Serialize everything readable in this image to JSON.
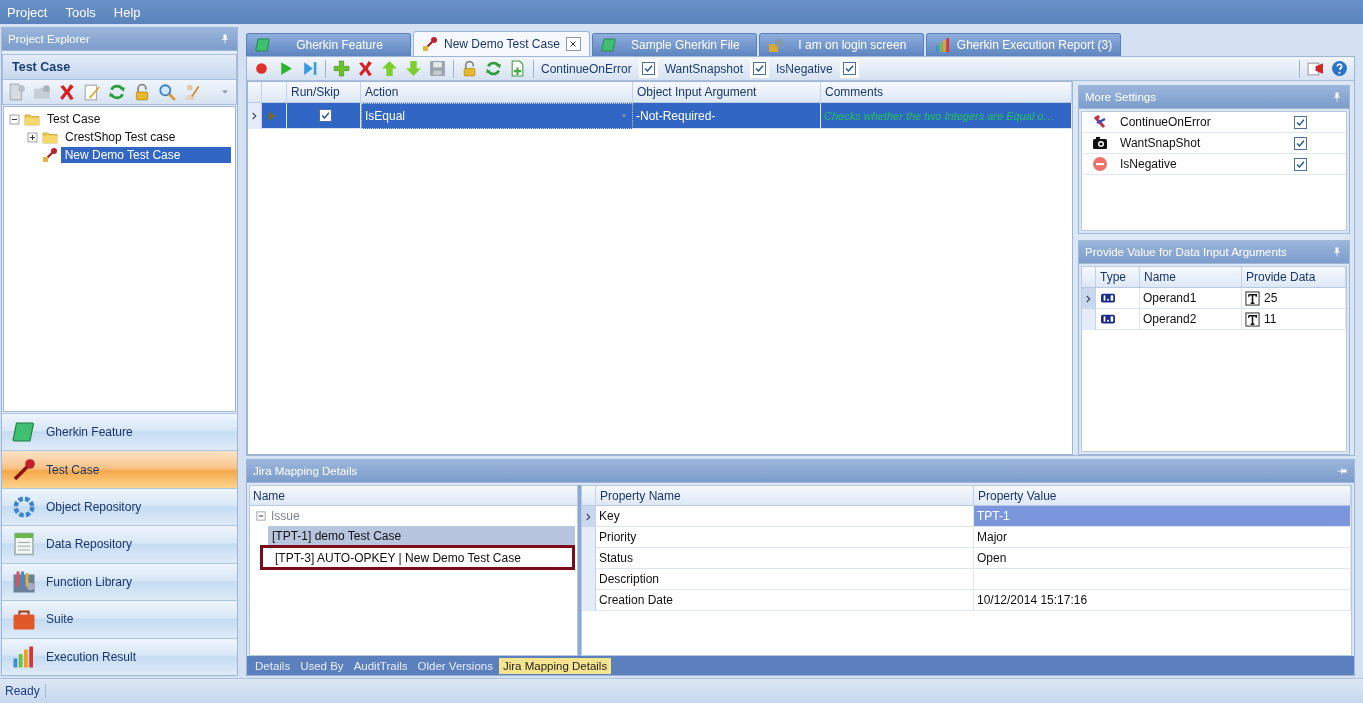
{
  "menu": [
    {
      "label": "Project"
    },
    {
      "label": "Tools"
    },
    {
      "label": "Help"
    }
  ],
  "explorer": {
    "title": "Project Explorer",
    "section_title": "Test Case",
    "tree": [
      {
        "label": "Test Case",
        "kind": "folder",
        "expanded": true,
        "selected": false,
        "children": [
          {
            "label": "CrestShop Test case",
            "kind": "folder",
            "expanded": false,
            "selected": false
          },
          {
            "label": "New Demo Test Case",
            "kind": "test_case",
            "selected": true
          }
        ]
      }
    ]
  },
  "nav": [
    {
      "label": "Gherkin Feature",
      "kind": "feature",
      "selected": false
    },
    {
      "label": "Test Case",
      "kind": "test_case",
      "selected": true
    },
    {
      "label": "Object Repository",
      "kind": "object_repository",
      "selected": false
    },
    {
      "label": "Data Repository",
      "kind": "data_repository",
      "selected": false
    },
    {
      "label": "Function Library",
      "kind": "function_library",
      "selected": false
    },
    {
      "label": "Suite",
      "kind": "suite",
      "selected": false
    },
    {
      "label": "Execution Result",
      "kind": "report",
      "selected": false
    }
  ],
  "tabs": [
    {
      "label": "Gherkin Feature",
      "kind": "feature",
      "selected": false
    },
    {
      "label": "New Demo Test Case",
      "kind": "test_case",
      "selected": true
    },
    {
      "label": "Sample Gherkin File",
      "kind": "feature",
      "selected": false
    },
    {
      "label": "I am on login screen",
      "kind": "screen",
      "selected": false
    },
    {
      "label": "Gherkin Execution Report (3)",
      "kind": "report",
      "selected": false
    }
  ],
  "toolbar_options": [
    {
      "label": "ContinueOnError",
      "checked": true
    },
    {
      "label": "WantSnapshot",
      "checked": true
    },
    {
      "label": "IsNegative",
      "checked": true
    }
  ],
  "steps_table": {
    "columns": [
      "Run/Skip",
      "Action",
      "Object Input Argument",
      "Comments"
    ],
    "rows": [
      {
        "run": true,
        "action": "IsEqual",
        "object_input_argument": "-Not-Required-",
        "comment": "Checks whether the two Integers are Equal o…",
        "selected": true
      }
    ]
  },
  "more_settings": {
    "title": "More Settings",
    "items": [
      {
        "label": "ContinueOnError",
        "kind": "continue",
        "checked": true
      },
      {
        "label": "WantSnapShot",
        "kind": "snapshot",
        "checked": true
      },
      {
        "label": "IsNegative",
        "kind": "negative",
        "checked": true
      }
    ]
  },
  "data_inputs": {
    "title": "Provide Value for Data Input Arguments",
    "columns": [
      "Type",
      "Name",
      "Provide Data"
    ],
    "rows": [
      {
        "name": "Operand1",
        "value": "25",
        "selected": true
      },
      {
        "name": "Operand2",
        "value": "11",
        "selected": false
      }
    ]
  },
  "jira": {
    "title": "Jira Mapping Details",
    "name_column": "Name",
    "group": {
      "label": "Issue",
      "expanded": true
    },
    "issues": [
      {
        "label": "[TPT-1] demo Test Case",
        "selected": true,
        "highlighted": false
      },
      {
        "label": "[TPT-3] AUTO-OPKEY | New Demo Test Case",
        "selected": false,
        "highlighted": true
      }
    ],
    "property_columns": [
      "Property Name",
      "Property Value"
    ],
    "properties": [
      {
        "name": "Key",
        "value": "TPT-1",
        "selected": true
      },
      {
        "name": "Priority",
        "value": "Major",
        "selected": false
      },
      {
        "name": "Status",
        "value": "Open",
        "selected": false
      },
      {
        "name": "Description",
        "selected": false
      },
      {
        "name": "Creation Date",
        "value": "10/12/2014 15:17:16",
        "selected": false
      }
    ]
  },
  "bottom_tabs": [
    {
      "label": "Details",
      "selected": false
    },
    {
      "label": "Used By",
      "selected": false
    },
    {
      "label": "AuditTrails",
      "selected": false
    },
    {
      "label": "Older Versions",
      "selected": false
    },
    {
      "label": "Jira Mapping Details",
      "selected": true
    }
  ],
  "status_bar": {
    "text": "Ready"
  }
}
